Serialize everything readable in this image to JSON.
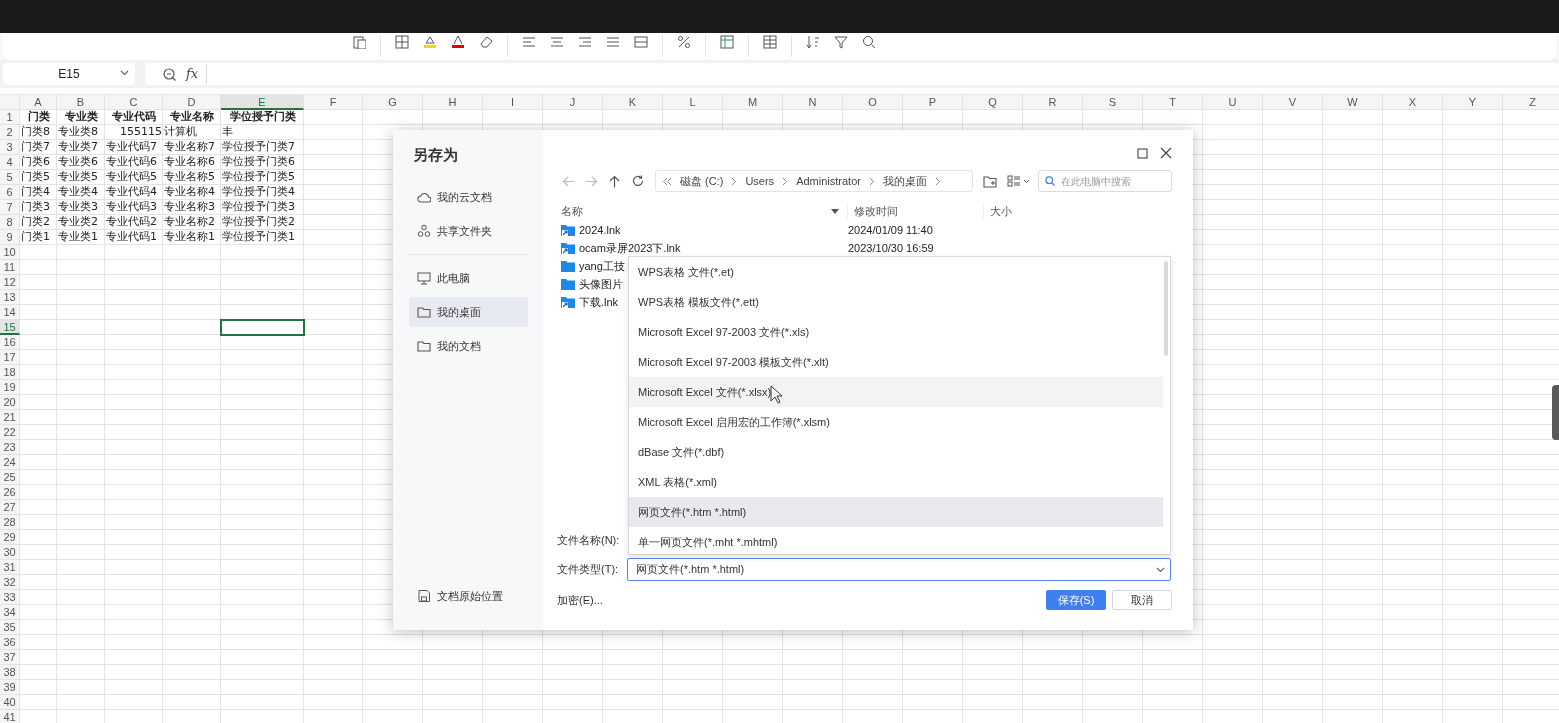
{
  "formula_bar": {
    "cell_ref": "E15",
    "fx": "fx"
  },
  "sheet": {
    "columns": [
      {
        "label": "A",
        "selected": false
      },
      {
        "label": "B",
        "selected": false
      },
      {
        "label": "C",
        "selected": false
      },
      {
        "label": "D",
        "selected": false
      },
      {
        "label": "E",
        "selected": true
      },
      {
        "label": "F",
        "selected": false
      },
      {
        "label": "G",
        "selected": false
      },
      {
        "label": "H",
        "selected": false
      },
      {
        "label": "I",
        "selected": false
      },
      {
        "label": "J",
        "selected": false
      },
      {
        "label": "K",
        "selected": false
      },
      {
        "label": "L",
        "selected": false
      },
      {
        "label": "M",
        "selected": false
      },
      {
        "label": "N",
        "selected": false
      },
      {
        "label": "O",
        "selected": false
      },
      {
        "label": "P",
        "selected": false
      },
      {
        "label": "Q",
        "selected": false
      },
      {
        "label": "R",
        "selected": false
      },
      {
        "label": "S",
        "selected": false
      },
      {
        "label": "T",
        "selected": false
      },
      {
        "label": "U",
        "selected": false
      },
      {
        "label": "V",
        "selected": false
      },
      {
        "label": "W",
        "selected": false
      },
      {
        "label": "X",
        "selected": false
      },
      {
        "label": "Y",
        "selected": false
      },
      {
        "label": "Z",
        "selected": false
      }
    ],
    "rows": [
      {
        "label": "1",
        "selected": false,
        "kind": "header",
        "cells": [
          "门类",
          "专业类",
          "专业代码",
          "专业名称",
          "学位授予门类"
        ]
      },
      {
        "label": "2",
        "selected": false,
        "kind": "data",
        "cells": [
          "门类8",
          "专业类8",
          {
            "text": "155115",
            "kind": "number"
          },
          "计算机",
          "丰"
        ]
      },
      {
        "label": "3",
        "selected": false,
        "kind": "data",
        "cells": [
          "门类7",
          "专业类7",
          "专业代码7",
          "专业名称7",
          "学位授予门类7"
        ]
      },
      {
        "label": "4",
        "selected": false,
        "kind": "data",
        "cells": [
          "门类6",
          "专业类6",
          "专业代码6",
          "专业名称6",
          "学位授予门类6"
        ]
      },
      {
        "label": "5",
        "selected": false,
        "kind": "data",
        "cells": [
          "门类5",
          "专业类5",
          "专业代码5",
          "专业名称5",
          "学位授予门类5"
        ]
      },
      {
        "label": "6",
        "selected": false,
        "kind": "data",
        "cells": [
          "门类4",
          "专业类4",
          "专业代码4",
          "专业名称4",
          "学位授予门类4"
        ]
      },
      {
        "label": "7",
        "selected": false,
        "kind": "data",
        "cells": [
          "门类3",
          "专业类3",
          "专业代码3",
          "专业名称3",
          "学位授予门类3"
        ]
      },
      {
        "label": "8",
        "selected": false,
        "kind": "data",
        "cells": [
          "门类2",
          "专业类2",
          "专业代码2",
          "专业名称2",
          "学位授予门类2"
        ]
      },
      {
        "label": "9",
        "selected": false,
        "kind": "data",
        "cells": [
          "门类1",
          "专业类1",
          "专业代码1",
          "专业名称1",
          "学位授予门类1"
        ]
      },
      {
        "label": "10",
        "selected": false
      },
      {
        "label": "11",
        "selected": false
      },
      {
        "label": "12",
        "selected": false
      },
      {
        "label": "13",
        "selected": false
      },
      {
        "label": "14",
        "selected": false
      },
      {
        "label": "15",
        "selected": true
      },
      {
        "label": "16",
        "selected": false
      },
      {
        "label": "17",
        "selected": false
      },
      {
        "label": "18",
        "selected": false
      },
      {
        "label": "19",
        "selected": false
      },
      {
        "label": "20",
        "selected": false
      },
      {
        "label": "21",
        "selected": false
      },
      {
        "label": "22",
        "selected": false
      },
      {
        "label": "23",
        "selected": false
      },
      {
        "label": "24",
        "selected": false
      },
      {
        "label": "25",
        "selected": false
      },
      {
        "label": "26",
        "selected": false
      },
      {
        "label": "27",
        "selected": false
      },
      {
        "label": "28",
        "selected": false
      },
      {
        "label": "29",
        "selected": false
      },
      {
        "label": "30",
        "selected": false
      },
      {
        "label": "31",
        "selected": false
      },
      {
        "label": "32",
        "selected": false
      },
      {
        "label": "33",
        "selected": false
      },
      {
        "label": "34",
        "selected": false
      },
      {
        "label": "35",
        "selected": false
      },
      {
        "label": "36",
        "selected": false
      },
      {
        "label": "37",
        "selected": false
      },
      {
        "label": "38",
        "selected": false
      },
      {
        "label": "39",
        "selected": false
      },
      {
        "label": "40",
        "selected": false
      },
      {
        "label": "41",
        "selected": false
      }
    ]
  },
  "dialog": {
    "title": "另存为",
    "sidebar": [
      {
        "label": "我的云文档",
        "kind": "cloud",
        "selected": false
      },
      {
        "label": "共享文件夹",
        "kind": "share",
        "selected": false
      },
      {
        "label": "此电脑",
        "kind": "computer",
        "selected": false
      },
      {
        "label": "我的桌面",
        "kind": "folder",
        "selected": true
      },
      {
        "label": "我的文档",
        "kind": "folder",
        "selected": false
      }
    ],
    "sidebar_footer": "文档原始位置",
    "breadcrumb": [
      "磁盘 (C:)",
      "Users",
      "Administrator",
      "我的桌面"
    ],
    "search": {
      "placeholder": "在此电脑中搜索"
    },
    "file_columns": [
      "名称",
      "修改时间",
      "大小"
    ],
    "files": [
      {
        "name": "2024.lnk",
        "modified": "2024/01/09 11:40",
        "kind": "shortcut"
      },
      {
        "name": "ocam录屏2023下.lnk",
        "modified": "2023/10/30 16:59",
        "kind": "shortcut"
      },
      {
        "name": "yang工技",
        "kind": "folder"
      },
      {
        "name": "头像图片",
        "kind": "folder"
      },
      {
        "name": "下载.lnk",
        "kind": "shortcut"
      }
    ],
    "filename_label": "文件名称(N):",
    "filetype_label": "文件类型(T):",
    "filetype_value": "网页文件(*.htm *.html)",
    "filetype_options": [
      {
        "label": "WPS表格 文件(*.et)",
        "selected": false,
        "hovered": false
      },
      {
        "label": "WPS表格 模板文件(*.ett)",
        "selected": false,
        "hovered": false
      },
      {
        "label": "Microsoft Excel 97-2003 文件(*.xls)",
        "selected": false,
        "hovered": false
      },
      {
        "label": "Microsoft Excel 97-2003 模板文件(*.xlt)",
        "selected": false,
        "hovered": false
      },
      {
        "label": "Microsoft Excel 文件(*.xlsx)",
        "selected": false,
        "hovered": true
      },
      {
        "label": "Microsoft Excel 启用宏的工作簿(*.xlsm)",
        "selected": false,
        "hovered": false
      },
      {
        "label": "dBase 文件(*.dbf)",
        "selected": false,
        "hovered": false
      },
      {
        "label": "XML 表格(*.xml)",
        "selected": false,
        "hovered": false
      },
      {
        "label": "网页文件(*.htm *.html)",
        "selected": true,
        "hovered": false
      },
      {
        "label": "单一网页文件(*.mht *.mhtml)",
        "selected": false,
        "hovered": false
      }
    ],
    "encrypt_link": "加密(E)...",
    "buttons": [
      {
        "label": "保存(S)",
        "kind": "primary"
      },
      {
        "label": "取消",
        "kind": "secondary"
      }
    ]
  }
}
